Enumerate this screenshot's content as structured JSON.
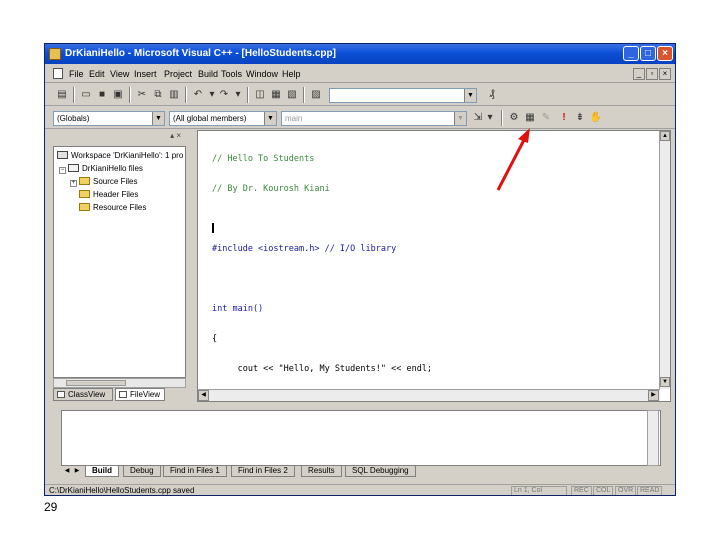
{
  "window": {
    "title": "DrKianiHello - Microsoft Visual C++ - [HelloStudents.cpp]",
    "minimize_glyph": "_",
    "maximize_glyph": "□",
    "close_glyph": "×"
  },
  "menubar": {
    "items": [
      "File",
      "Edit",
      "View",
      "Insert",
      "Project",
      "Build",
      "Tools",
      "Window",
      "Help"
    ],
    "mdi_buttons": [
      "_",
      "▫",
      "×"
    ]
  },
  "toolbar": {
    "find_value": ""
  },
  "wizardbar": {
    "class_combo": "(Globals)",
    "members_combo": "(All global members)",
    "function_combo": "main"
  },
  "workspace": {
    "tree": [
      "Workspace 'DrKianiHello': 1 pro",
      "DrKianiHello files",
      "Source Files",
      "Header Files",
      "Resource Files"
    ],
    "tabs": [
      "ClassView",
      "FileView"
    ]
  },
  "editor": {
    "lines": [
      "// Hello To Students",
      "// By Dr. Kourosh Kiani",
      "",
      "#include <iostream.h> // I/O library",
      "",
      "int main()",
      "{",
      "     cout << \"Hello, My Students!\" << endl;",
      "}"
    ]
  },
  "output": {
    "tabs": [
      "Build",
      "Debug",
      "Find in Files 1",
      "Find in Files 2",
      "Results",
      "SQL Debugging"
    ]
  },
  "statusbar": {
    "message": "C:\\DrKianiHello\\HelloStudents.cpp saved",
    "position": "Ln 1, Col",
    "indicators": [
      "REC",
      "COL",
      "OVR",
      "READ"
    ]
  },
  "slide": {
    "number": "29"
  },
  "colors": {
    "titlebar": "#0a50d6",
    "annotation_arrow": "#e01010"
  },
  "icons": {
    "arrow_annotation": "red-arrow-pointing-to-compile-toolbar",
    "compile_toolbar": [
      "compile-icon",
      "build-icon",
      "stop-build-icon",
      "execute-icon",
      "go-icon",
      "breakpoint-icon"
    ]
  }
}
